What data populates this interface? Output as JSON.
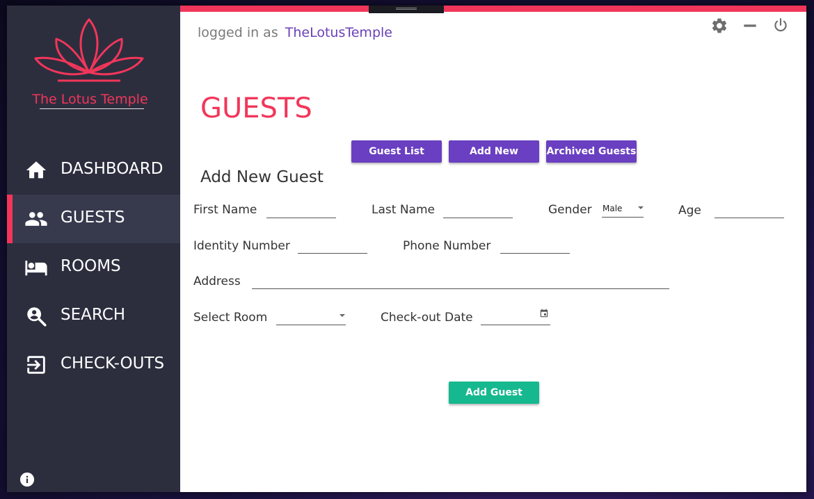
{
  "brand": {
    "name": "The Lotus Temple",
    "logo_icon": "lotus-icon",
    "accent_color": "#f2365a"
  },
  "sidebar": {
    "items": [
      {
        "label": "DASHBOARD",
        "icon": "home-icon",
        "active": false
      },
      {
        "label": "GUESTS",
        "icon": "people-icon",
        "active": true
      },
      {
        "label": "ROOMS",
        "icon": "bed-icon",
        "active": false
      },
      {
        "label": "SEARCH",
        "icon": "person-search-icon",
        "active": false
      },
      {
        "label": "CHECK-OUTS",
        "icon": "exit-icon",
        "active": false
      }
    ],
    "footer_icon": "info-icon",
    "background": "#2c2e3e"
  },
  "header": {
    "logged_in_prefix": "logged in as",
    "username": "TheLotusTemple",
    "controls": [
      "gear-icon",
      "minimize-icon",
      "power-icon"
    ]
  },
  "page": {
    "title": "GUESTS",
    "tabs": [
      "Guest List",
      "Add New",
      "Archived Guests"
    ],
    "tab_color": "#6a3fc1"
  },
  "form": {
    "title": "Add New Guest",
    "first_name_label": "First Name",
    "first_name_value": "",
    "last_name_label": "Last Name",
    "last_name_value": "",
    "gender_label": "Gender",
    "gender_value": "Male",
    "age_label": "Age",
    "age_value": "",
    "identity_label": "Identity Number",
    "identity_value": "",
    "phone_label": "Phone Number",
    "phone_value": "",
    "address_label": "Address",
    "address_value": "",
    "room_label": "Select Room",
    "room_value": "",
    "checkout_label": "Check-out Date",
    "checkout_value": "",
    "calendar_icon": "calendar-icon",
    "submit_label": "Add Guest",
    "submit_color": "#16b88f"
  }
}
